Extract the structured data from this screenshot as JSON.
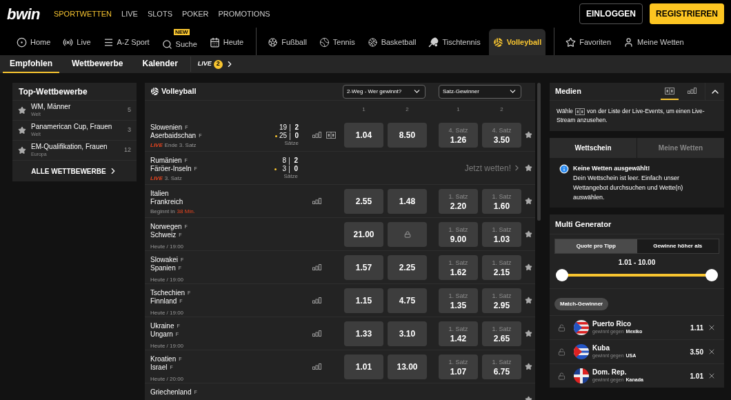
{
  "brand": {
    "logo": "bwin"
  },
  "top_nav": [
    {
      "label": "SPORTWETTEN",
      "selected": true
    },
    {
      "label": "LIVE",
      "selected": false
    },
    {
      "label": "SLOTS",
      "selected": false
    },
    {
      "label": "POKER",
      "selected": false
    },
    {
      "label": "PROMOTIONS",
      "selected": false
    }
  ],
  "auth_buttons": [
    {
      "label": "EINLOGGEN",
      "kind": "outline"
    },
    {
      "label": "REGISTRIEREN",
      "kind": "primary"
    }
  ],
  "sport_nav": {
    "groups": [
      {
        "items": [
          {
            "label": "Home",
            "selected": false
          },
          {
            "label": "Live",
            "selected": false
          },
          {
            "label": "A-Z Sport",
            "selected": false
          },
          {
            "label": "Suche",
            "selected": false,
            "badge": "NEW"
          },
          {
            "label": "Heute",
            "selected": false
          }
        ]
      },
      {
        "items": [
          {
            "label": "Fußball",
            "selected": false
          },
          {
            "label": "Tennis",
            "selected": false
          },
          {
            "label": "Basketball",
            "selected": false
          },
          {
            "label": "Tischtennis",
            "selected": false
          },
          {
            "label": "Volleyball",
            "selected": true
          }
        ]
      },
      {
        "items": [
          {
            "label": "Favoriten",
            "selected": false
          },
          {
            "label": "Meine Wetten",
            "selected": false
          }
        ]
      }
    ]
  },
  "sub_tabs": [
    {
      "label": "Empfohlen",
      "selected": true
    },
    {
      "label": "Wettbewerbe",
      "selected": false
    },
    {
      "label": "Kalender",
      "selected": false
    }
  ],
  "live_tab": {
    "label": "LIVE",
    "count": "2"
  },
  "top_competitions": {
    "title": "Top-Wettbewerbe",
    "items": [
      {
        "name": "WM, Männer",
        "region": "Welt",
        "count": "5"
      },
      {
        "name": "Panamerican Cup, Frauen",
        "region": "Welt",
        "count": "3"
      },
      {
        "name": "EM-Qualifikation, Frauen",
        "region": "Europa",
        "count": "12"
      }
    ],
    "footer": "ALLE WETTBEWERBE"
  },
  "events": {
    "title": "Volleyball",
    "market_selects": [
      {
        "value": "2-Weg - Wer gewinnt?"
      },
      {
        "value": "Satz-Gewinner"
      }
    ],
    "column_labels": [
      "1",
      "2",
      "1",
      "2"
    ],
    "rows": [
      {
        "teams": [
          {
            "name": "Slowenien",
            "gender": "F"
          },
          {
            "name": "Aserbaidschan",
            "gender": "F"
          }
        ],
        "status": {
          "kind": "live",
          "live_label": "LIVE",
          "text": "Ende 3. Satz"
        },
        "score": {
          "sets_label": "Sätze",
          "teams": [
            {
              "points": "19",
              "sets": "2",
              "serving": false
            },
            {
              "points": "25",
              "sets": "0",
              "serving": true
            }
          ]
        },
        "stats": true,
        "stream": true,
        "odds": [
          {
            "value": "1.04",
            "locked": false
          },
          {
            "value": "8.50",
            "locked": false
          }
        ],
        "set_odds": [
          {
            "label": "4. Satz",
            "value": "1.26"
          },
          {
            "label": "4. Satz",
            "value": "3.50"
          }
        ]
      },
      {
        "teams": [
          {
            "name": "Rumänien",
            "gender": "F"
          },
          {
            "name": "Färöer-Inseln",
            "gender": "F"
          }
        ],
        "status": {
          "kind": "live",
          "live_label": "LIVE",
          "text": "3. Satz"
        },
        "score": {
          "sets_label": "Sätze",
          "teams": [
            {
              "points": "8",
              "sets": "2",
              "serving": false
            },
            {
              "points": "3",
              "sets": "0",
              "serving": true
            }
          ]
        },
        "stats": false,
        "stream": false,
        "cta": "Jetzt wetten!"
      },
      {
        "teams": [
          {
            "name": "Italien"
          },
          {
            "name": "Frankreich"
          }
        ],
        "status": {
          "kind": "countdown",
          "text": "Beginnt in",
          "highlight": "38 Min."
        },
        "stats": true,
        "stream": false,
        "odds": [
          {
            "value": "2.55",
            "locked": false
          },
          {
            "value": "1.48",
            "locked": false
          }
        ],
        "set_odds": [
          {
            "label": "1. Satz",
            "value": "2.20"
          },
          {
            "label": "1. Satz",
            "value": "1.60"
          }
        ]
      },
      {
        "teams": [
          {
            "name": "Norwegen",
            "gender": "F"
          },
          {
            "name": "Schweiz",
            "gender": "F"
          }
        ],
        "status": {
          "kind": "scheduled",
          "text": "Heute / 19:00"
        },
        "stats": false,
        "stream": false,
        "odds": [
          {
            "value": "21.00",
            "locked": false
          },
          {
            "locked": true
          }
        ],
        "set_odds": [
          {
            "label": "1. Satz",
            "value": "9.00"
          },
          {
            "label": "1. Satz",
            "value": "1.03"
          }
        ]
      },
      {
        "teams": [
          {
            "name": "Slowakei",
            "gender": "F"
          },
          {
            "name": "Spanien",
            "gender": "F"
          }
        ],
        "status": {
          "kind": "scheduled",
          "text": "Heute / 19:00"
        },
        "stats": true,
        "stream": false,
        "odds": [
          {
            "value": "1.57",
            "locked": false
          },
          {
            "value": "2.25",
            "locked": false
          }
        ],
        "set_odds": [
          {
            "label": "1. Satz",
            "value": "1.62"
          },
          {
            "label": "1. Satz",
            "value": "2.15"
          }
        ]
      },
      {
        "teams": [
          {
            "name": "Tschechien",
            "gender": "F"
          },
          {
            "name": "Finnland",
            "gender": "F"
          }
        ],
        "status": {
          "kind": "scheduled",
          "text": "Heute / 19:00"
        },
        "stats": true,
        "stream": false,
        "odds": [
          {
            "value": "1.15",
            "locked": false
          },
          {
            "value": "4.75",
            "locked": false
          }
        ],
        "set_odds": [
          {
            "label": "1. Satz",
            "value": "1.35"
          },
          {
            "label": "1. Satz",
            "value": "2.95"
          }
        ]
      },
      {
        "teams": [
          {
            "name": "Ukraine",
            "gender": "F"
          },
          {
            "name": "Ungarn",
            "gender": "F"
          }
        ],
        "status": {
          "kind": "scheduled",
          "text": "Heute / 19:00"
        },
        "stats": true,
        "stream": false,
        "odds": [
          {
            "value": "1.33",
            "locked": false
          },
          {
            "value": "3.10",
            "locked": false
          }
        ],
        "set_odds": [
          {
            "label": "1. Satz",
            "value": "1.42"
          },
          {
            "label": "1. Satz",
            "value": "2.65"
          }
        ]
      },
      {
        "teams": [
          {
            "name": "Kroatien",
            "gender": "F"
          },
          {
            "name": "Israel",
            "gender": "F"
          }
        ],
        "status": {
          "kind": "scheduled",
          "text": "Heute / 20:00"
        },
        "stats": true,
        "stream": false,
        "odds": [
          {
            "value": "1.01",
            "locked": false
          },
          {
            "value": "13.00",
            "locked": false
          }
        ],
        "set_odds": [
          {
            "label": "1. Satz",
            "value": "1.07"
          },
          {
            "label": "1. Satz",
            "value": "6.75"
          }
        ]
      },
      {
        "teams": [
          {
            "name": "Griechenland",
            "gender": "F"
          }
        ],
        "stats": false,
        "stream": false
      }
    ]
  },
  "media": {
    "title": "Medien",
    "tabs": [
      {
        "selected": true
      },
      {
        "selected": false
      }
    ],
    "text_before": "Wähle",
    "text_after": [
      "von der Liste der Live-Events, um einen Live-",
      "Stream anzusehen."
    ]
  },
  "betslip": {
    "tabs": [
      {
        "label": "Wettschein",
        "selected": true
      },
      {
        "label": "Meine Wetten",
        "selected": false
      }
    ],
    "notice_title": "Keine Wetten ausgewählt!",
    "notice_body": "Dein Wettschein ist leer. Einfach unser Wettangebot durchsuchen und Wette(n) auswählen."
  },
  "multi_generator": {
    "title": "Multi Generator",
    "modes": [
      {
        "label": "Quote pro Tipp",
        "selected": true
      },
      {
        "label": "Gewinne höher als",
        "selected": false
      }
    ],
    "range_label": "1.01 - 10.00",
    "range": {
      "low": {
        "level": 0
      },
      "high": {
        "level": 1
      }
    },
    "chip": "Match-Gewinner",
    "picks": [
      {
        "team": "Puerto Rico",
        "relation": "gewinnt gegen",
        "opponent": "Mexiko",
        "odds": "1.11"
      },
      {
        "team": "Kuba",
        "relation": "gewinnt gegen",
        "opponent": "USA",
        "odds": "3.50"
      },
      {
        "team": "Dom. Rep.",
        "relation": "gewinnt gegen",
        "opponent": "Kanada",
        "odds": "1.01"
      }
    ]
  }
}
